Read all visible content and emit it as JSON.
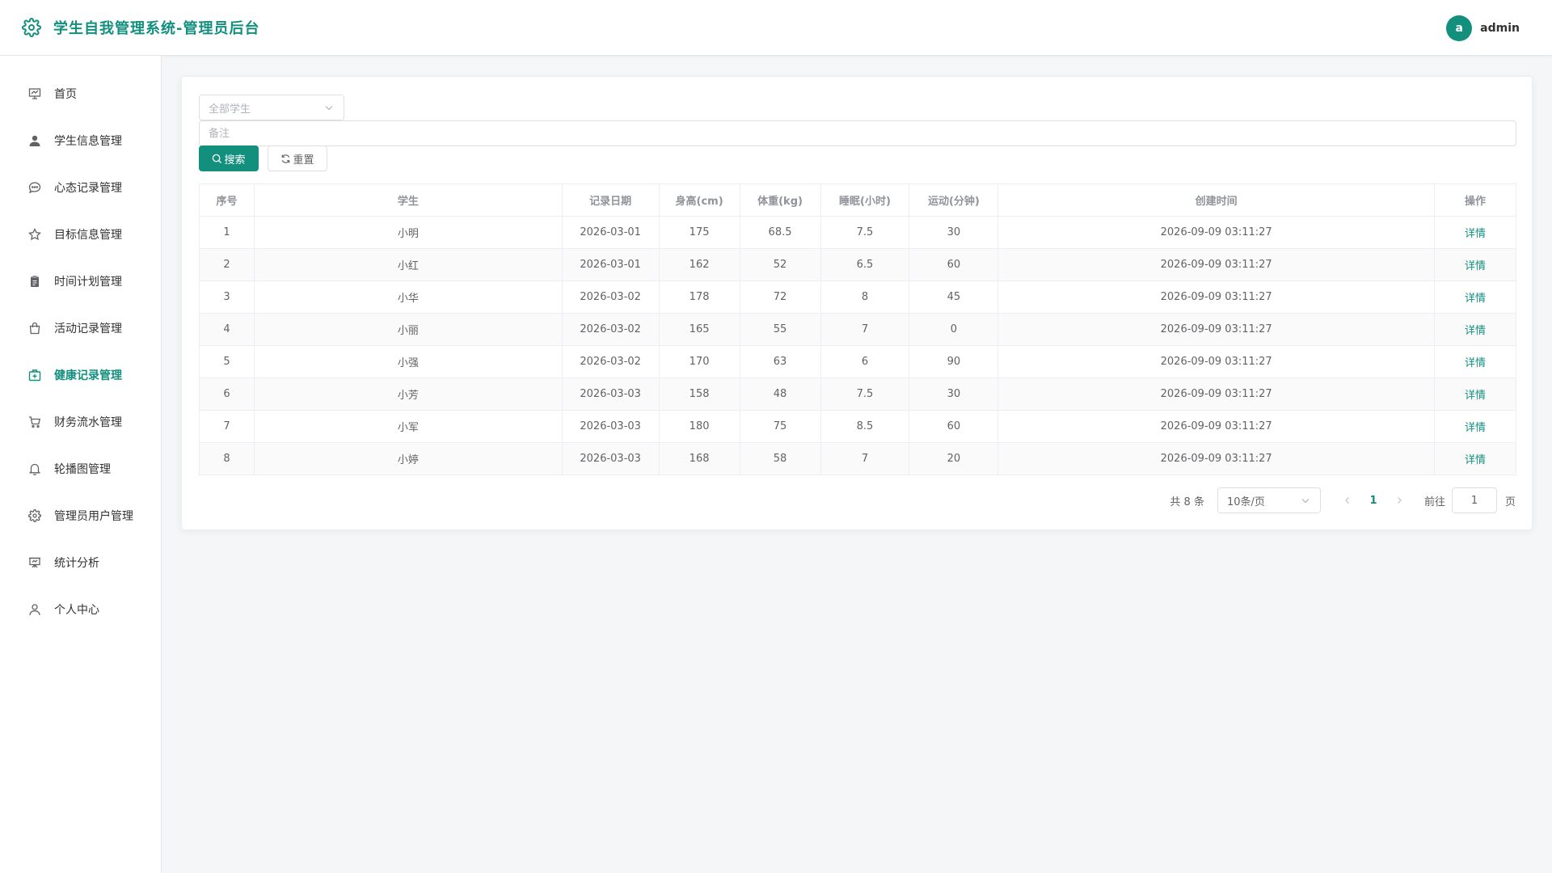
{
  "app": {
    "title": "学生自我管理系统-管理员后台",
    "accent": "#138f7e"
  },
  "user": {
    "avatar_letter": "a",
    "name": "admin"
  },
  "sidebar": {
    "items": [
      {
        "label": "首页",
        "icon": "chart-board-icon"
      },
      {
        "label": "学生信息管理",
        "icon": "user-filled-icon"
      },
      {
        "label": "心态记录管理",
        "icon": "chat-icon"
      },
      {
        "label": "目标信息管理",
        "icon": "star-icon"
      },
      {
        "label": "时间计划管理",
        "icon": "clipboard-icon"
      },
      {
        "label": "活动记录管理",
        "icon": "bag-icon"
      },
      {
        "label": "健康记录管理",
        "icon": "first-aid-icon"
      },
      {
        "label": "财务流水管理",
        "icon": "cart-icon"
      },
      {
        "label": "轮播图管理",
        "icon": "bell-icon"
      },
      {
        "label": "管理员用户管理",
        "icon": "gear-icon"
      },
      {
        "label": "统计分析",
        "icon": "presentation-icon"
      },
      {
        "label": "个人中心",
        "icon": "user-outline-icon"
      }
    ],
    "active_index": 6
  },
  "filters": {
    "student_select_placeholder": "全部学生",
    "note_placeholder": "备注",
    "search_label": "搜索",
    "reset_label": "重置"
  },
  "table": {
    "columns": [
      "序号",
      "学生",
      "记录日期",
      "身高(cm)",
      "体重(kg)",
      "睡眠(小时)",
      "运动(分钟)",
      "创建时间",
      "操作"
    ],
    "rows": [
      [
        "1",
        "小明",
        "2026-03-01",
        "175",
        "68.5",
        "7.5",
        "30",
        "2026-09-09 03:11:27",
        "详情"
      ],
      [
        "2",
        "小红",
        "2026-03-01",
        "162",
        "52",
        "6.5",
        "60",
        "2026-09-09 03:11:27",
        "详情"
      ],
      [
        "3",
        "小华",
        "2026-03-02",
        "178",
        "72",
        "8",
        "45",
        "2026-09-09 03:11:27",
        "详情"
      ],
      [
        "4",
        "小丽",
        "2026-03-02",
        "165",
        "55",
        "7",
        "0",
        "2026-09-09 03:11:27",
        "详情"
      ],
      [
        "5",
        "小强",
        "2026-03-02",
        "170",
        "63",
        "6",
        "90",
        "2026-09-09 03:11:27",
        "详情"
      ],
      [
        "6",
        "小芳",
        "2026-03-03",
        "158",
        "48",
        "7.5",
        "30",
        "2026-09-09 03:11:27",
        "详情"
      ],
      [
        "7",
        "小军",
        "2026-03-03",
        "180",
        "75",
        "8.5",
        "60",
        "2026-09-09 03:11:27",
        "详情"
      ],
      [
        "8",
        "小婷",
        "2026-03-03",
        "168",
        "58",
        "7",
        "20",
        "2026-09-09 03:11:27",
        "详情"
      ]
    ]
  },
  "pagination": {
    "total_text": "共 8 条",
    "page_size": "10条/页",
    "current_page": "1",
    "goto_label": "前往",
    "goto_value": "1",
    "page_suffix": "页"
  }
}
